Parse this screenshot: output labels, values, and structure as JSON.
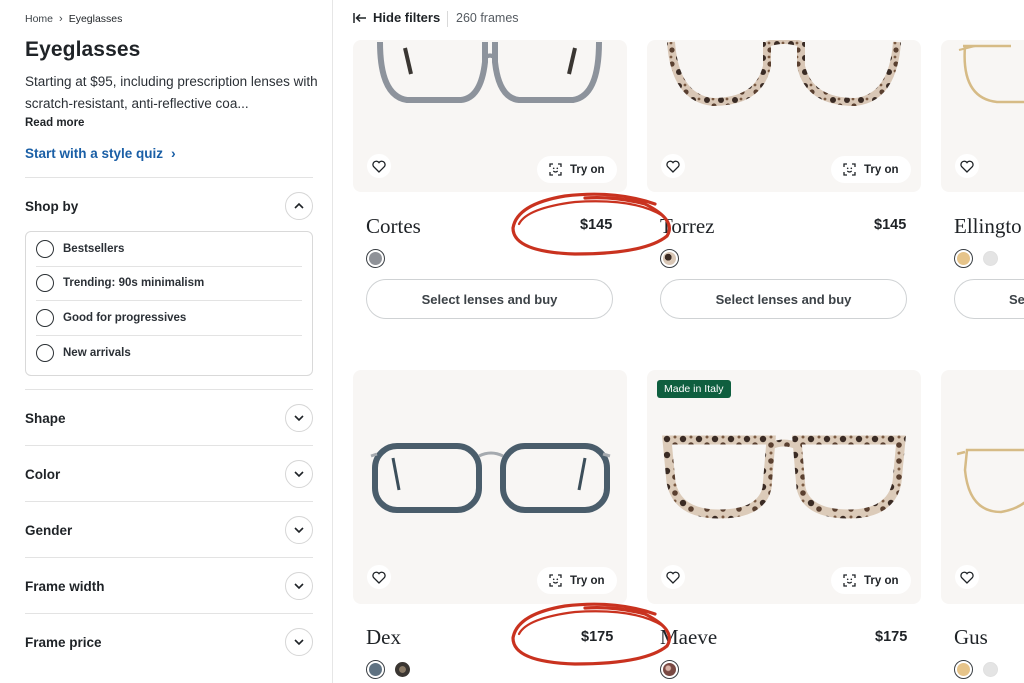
{
  "breadcrumb": {
    "home": "Home",
    "current": "Eyeglasses"
  },
  "page": {
    "title": "Eyeglasses",
    "description": "Starting at $95, including prescription lenses with scratch-resistant, anti-reflective coa...",
    "read_more": "Read more",
    "quiz_link": "Start with a style quiz"
  },
  "filters": {
    "shop_by": {
      "label": "Shop by",
      "options": [
        "Bestsellers",
        "Trending: 90s minimalism",
        "Good for progressives",
        "New arrivals"
      ]
    },
    "facets": [
      "Shape",
      "Color",
      "Gender",
      "Frame width",
      "Frame price"
    ]
  },
  "topbar": {
    "hide_filters": "Hide filters",
    "count": "260 frames"
  },
  "common": {
    "try_on": "Try on",
    "buy": "Select lenses and buy",
    "buy_partial": "Se"
  },
  "products": [
    {
      "name": "Cortes",
      "price": "$145",
      "swatches": [
        "#8f9298"
      ]
    },
    {
      "name": "Torrez",
      "price": "$145",
      "swatches": [
        "#6b5a4d"
      ]
    },
    {
      "name": "Ellingto",
      "price": "",
      "swatches": [
        "#e6c48a",
        "#d9d9d9"
      ]
    },
    {
      "name": "Dex",
      "price": "$175",
      "swatches": [
        "#5f7282",
        "#3a3632"
      ]
    },
    {
      "name": "Maeve",
      "price": "$175",
      "badge": "Made in Italy",
      "swatches": [
        "#7a4a44"
      ]
    },
    {
      "name": "Gus",
      "price": "",
      "swatches": [
        "#e6c48a",
        "#d9d9d9"
      ]
    }
  ],
  "colors": {
    "link": "#1a5fa6",
    "badge": "#0f5f3f",
    "annotation": "#c9321f"
  }
}
